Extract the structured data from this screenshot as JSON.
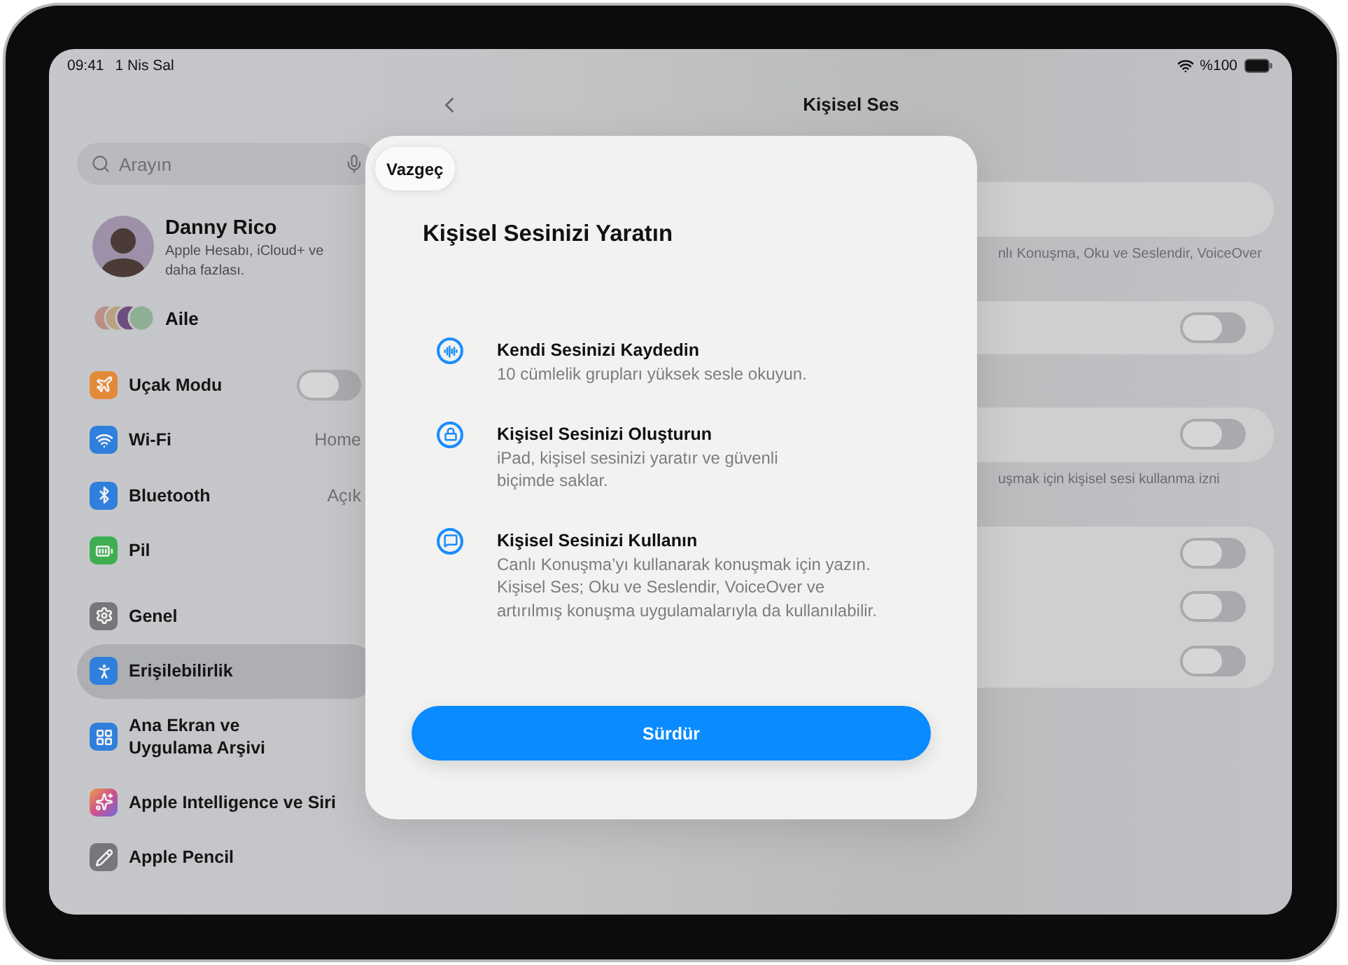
{
  "status_bar": {
    "time": "09:41",
    "date": "1 Nis Sal",
    "battery": "%100"
  },
  "sidebar": {
    "search": {
      "placeholder": "Arayın"
    },
    "profile": {
      "name": "Danny Rico",
      "subtitle": "Apple Hesabı, iCloud+ ve daha fazlası."
    },
    "family": {
      "label": "Aile"
    },
    "groups": [
      {
        "items": [
          {
            "label": "Uçak Modu",
            "kind": "toggle",
            "on": false,
            "selected": false
          },
          {
            "label": "Wi-Fi",
            "kind": "link",
            "value": "Home",
            "selected": false
          },
          {
            "label": "Bluetooth",
            "kind": "link",
            "value": "Açık",
            "selected": false
          },
          {
            "label": "Pil",
            "kind": "link",
            "selected": false
          }
        ]
      },
      {
        "items": [
          {
            "label": "Genel",
            "kind": "link",
            "selected": false
          },
          {
            "label": "Erişilebilirlik",
            "kind": "link",
            "selected": true
          },
          {
            "label": "Ana Ekran ve Uygulama Arşivi",
            "kind": "link",
            "selected": false
          },
          {
            "label": "Apple Intelligence ve Siri",
            "kind": "link",
            "selected": false
          },
          {
            "label": "Apple Pencil",
            "kind": "link",
            "selected": false
          }
        ]
      }
    ]
  },
  "detail": {
    "title": "Kişisel Ses",
    "sections": [
      {
        "rows": [
          {
            "kind": "plain"
          }
        ],
        "footer": "nlı Konuşma, Oku ve Seslendir, VoiceOver"
      },
      {
        "rows": [
          {
            "kind": "toggle",
            "on": false
          }
        ]
      },
      {
        "rows": [
          {
            "kind": "toggle",
            "on": false
          }
        ],
        "footer": "uşmak için kişisel sesi kullanma izni"
      },
      {
        "rows": [
          {
            "kind": "toggle",
            "on": false
          },
          {
            "kind": "toggle",
            "on": false
          },
          {
            "kind": "toggle",
            "on": false
          }
        ]
      }
    ]
  },
  "modal": {
    "cancel": "Vazgeç",
    "title": "Kişisel Sesinizi Yaratın",
    "steps": [
      {
        "title": "Kendi Sesinizi Kaydedin",
        "text": "10 cümlelik grupları yüksek sesle okuyun."
      },
      {
        "title": "Kişisel Sesinizi Oluşturun",
        "text": "iPad, kişisel sesinizi yaratır ve güvenli\nbiçimde saklar."
      },
      {
        "title": "Kişisel Sesinizi Kullanın",
        "text": "Canlı Konuşma’yı kullanarak konuşmak için yazın.\nKişisel Ses; Oku ve Seslendir, VoiceOver ve\nartırılmış konuşma uygulamalarıyla da kullanılabilir."
      }
    ],
    "continue": "Sürdür"
  }
}
